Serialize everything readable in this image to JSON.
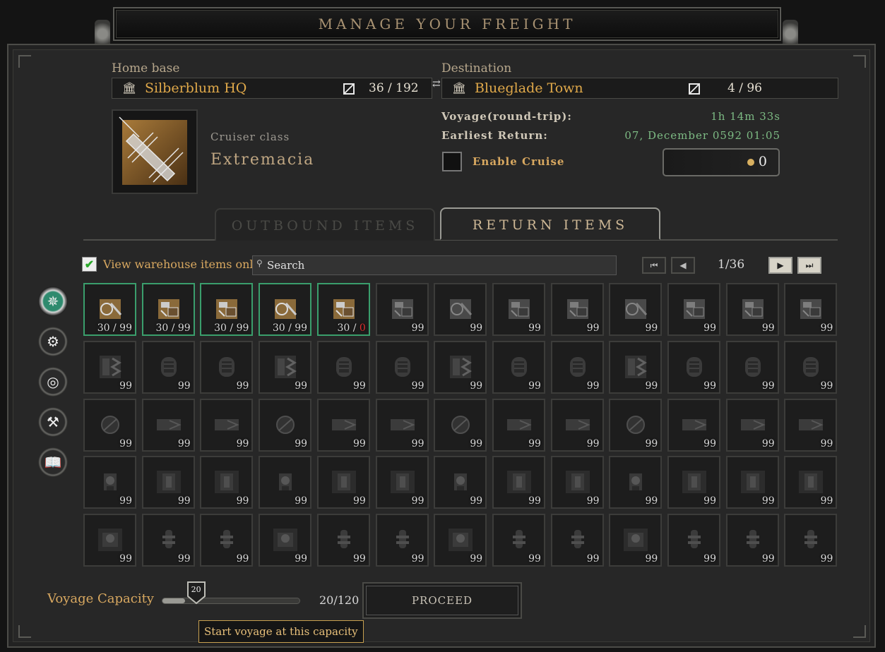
{
  "title": "MANAGE YOUR FREIGHT",
  "home": {
    "label": "Home base",
    "name": "Silberblum HQ",
    "count": "36 / 192"
  },
  "destination": {
    "label": "Destination",
    "name": "Blueglade Town",
    "count": "4 / 96"
  },
  "ship": {
    "class_label": "Cruiser class",
    "name": "Extremacia"
  },
  "voyage": {
    "label": "Voyage(round-trip):",
    "value": "1h 14m 33s"
  },
  "earliest": {
    "label": "Earliest Return:",
    "value": "07, December 0592 01:05"
  },
  "cruise": {
    "label": "Enable Cruise",
    "cost": "0"
  },
  "tabs": {
    "outbound": "OUTBOUND ITEMS",
    "return": "RETURN ITEMS"
  },
  "filter": {
    "checkbox_label": "View warehouse items only",
    "search_placeholder": "Search"
  },
  "pagination": {
    "page": "1/36"
  },
  "side_buttons": [
    "compass-icon",
    "gear-hand-icon",
    "coins-icon",
    "tools-icon",
    "book-icon"
  ],
  "grid": {
    "rows": [
      [
        {
          "t": "a",
          "q": "30 / 99",
          "active": true
        },
        {
          "t": "b",
          "q": "30 / 99",
          "active": true
        },
        {
          "t": "b",
          "q": "30 / 99",
          "active": true
        },
        {
          "t": "a",
          "q": "30 / 99",
          "active": true
        },
        {
          "t": "b",
          "q": "30 / ",
          "qz": "0",
          "active": true
        },
        {
          "t": "b",
          "q": "99"
        },
        {
          "t": "a",
          "q": "99"
        },
        {
          "t": "b",
          "q": "99"
        },
        {
          "t": "b",
          "q": "99"
        },
        {
          "t": "a",
          "q": "99"
        },
        {
          "t": "b",
          "q": "99"
        },
        {
          "t": "b",
          "q": "99"
        },
        {
          "t": "b",
          "q": "99"
        }
      ],
      [
        {
          "t": "c",
          "q": "99"
        },
        {
          "t": "d",
          "q": "99"
        },
        {
          "t": "d",
          "q": "99"
        },
        {
          "t": "c",
          "q": "99"
        },
        {
          "t": "d",
          "q": "99"
        },
        {
          "t": "d",
          "q": "99"
        },
        {
          "t": "c",
          "q": "99"
        },
        {
          "t": "d",
          "q": "99"
        },
        {
          "t": "d",
          "q": "99"
        },
        {
          "t": "c",
          "q": "99"
        },
        {
          "t": "d",
          "q": "99"
        },
        {
          "t": "d",
          "q": "99"
        },
        {
          "t": "d",
          "q": "99"
        }
      ],
      [
        {
          "t": "e",
          "q": "99"
        },
        {
          "t": "f",
          "q": "99"
        },
        {
          "t": "f",
          "q": "99"
        },
        {
          "t": "e",
          "q": "99"
        },
        {
          "t": "f",
          "q": "99"
        },
        {
          "t": "f",
          "q": "99"
        },
        {
          "t": "e",
          "q": "99"
        },
        {
          "t": "f",
          "q": "99"
        },
        {
          "t": "f",
          "q": "99"
        },
        {
          "t": "e",
          "q": "99"
        },
        {
          "t": "f",
          "q": "99"
        },
        {
          "t": "f",
          "q": "99"
        },
        {
          "t": "f",
          "q": "99"
        }
      ],
      [
        {
          "t": "g",
          "q": "99"
        },
        {
          "t": "h",
          "q": "99"
        },
        {
          "t": "h",
          "q": "99"
        },
        {
          "t": "g",
          "q": "99"
        },
        {
          "t": "h",
          "q": "99"
        },
        {
          "t": "h",
          "q": "99"
        },
        {
          "t": "g",
          "q": "99"
        },
        {
          "t": "h",
          "q": "99"
        },
        {
          "t": "h",
          "q": "99"
        },
        {
          "t": "g",
          "q": "99"
        },
        {
          "t": "h",
          "q": "99"
        },
        {
          "t": "h",
          "q": "99"
        },
        {
          "t": "h",
          "q": "99"
        }
      ],
      [
        {
          "t": "i",
          "q": "99"
        },
        {
          "t": "j",
          "q": "99"
        },
        {
          "t": "j",
          "q": "99"
        },
        {
          "t": "i",
          "q": "99"
        },
        {
          "t": "j",
          "q": "99"
        },
        {
          "t": "j",
          "q": "99"
        },
        {
          "t": "i",
          "q": "99"
        },
        {
          "t": "j",
          "q": "99"
        },
        {
          "t": "j",
          "q": "99"
        },
        {
          "t": "i",
          "q": "99"
        },
        {
          "t": "j",
          "q": "99"
        },
        {
          "t": "j",
          "q": "99"
        },
        {
          "t": "j",
          "q": "99"
        }
      ]
    ]
  },
  "capacity": {
    "label": "Voyage Capacity",
    "slider_value": "20",
    "value_fraction": 0.1667,
    "readout": "20/120",
    "tooltip": "Start voyage at this capacity"
  },
  "proceed": "PROCEED",
  "colors": {
    "accent_gold": "#e0a94a",
    "green_text": "#7dbb84",
    "active_border": "#3a9e6c",
    "warning_red": "#e03030"
  }
}
